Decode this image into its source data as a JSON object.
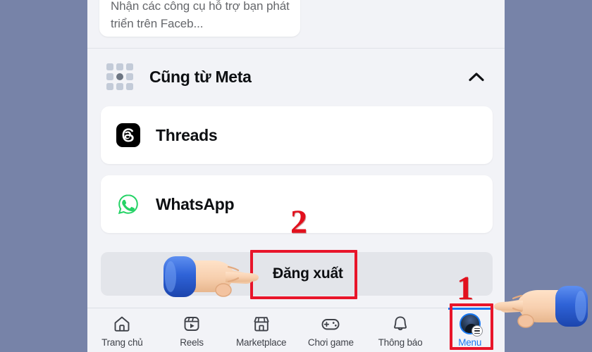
{
  "app": {
    "name": "Facebook",
    "screen": "Menu",
    "background_color": "#7783a8",
    "screen_background": "#f2f3f7"
  },
  "top_card": {
    "description": "Nhận các công cụ hỗ trợ bạn phát triển trên Faceb..."
  },
  "section": {
    "title": "Cũng từ Meta",
    "collapse_icon": "chevron-up-icon",
    "grid_icon": "meta-grid-icon"
  },
  "apps": [
    {
      "name": "Threads",
      "icon": "threads-icon",
      "icon_color": "#000000"
    },
    {
      "name": "WhatsApp",
      "icon": "whatsapp-icon",
      "icon_color": "#25d366"
    }
  ],
  "logout": {
    "label": "Đăng xuất",
    "background_color": "#e3e5ea"
  },
  "navbar": {
    "items": [
      {
        "label": "Trang chủ",
        "icon": "home-icon",
        "active": false
      },
      {
        "label": "Reels",
        "icon": "reels-icon",
        "active": false
      },
      {
        "label": "Marketplace",
        "icon": "marketplace-icon",
        "active": false
      },
      {
        "label": "Chơi game",
        "icon": "gamepad-icon",
        "active": false
      },
      {
        "label": "Thông báo",
        "icon": "bell-icon",
        "active": false
      },
      {
        "label": "Menu",
        "icon": "avatar-menu-icon",
        "active": true
      }
    ],
    "active_color": "#1878f2",
    "inactive_color": "#3f4249"
  },
  "annotations": {
    "color": "#e2101d",
    "steps": [
      {
        "number": "1",
        "target": "Menu"
      },
      {
        "number": "2",
        "target": "Đăng xuất"
      }
    ],
    "pointers": [
      {
        "name": "pointing-hand-right",
        "target": "Đăng xuất"
      },
      {
        "name": "pointing-hand-left",
        "target": "Menu"
      }
    ]
  }
}
